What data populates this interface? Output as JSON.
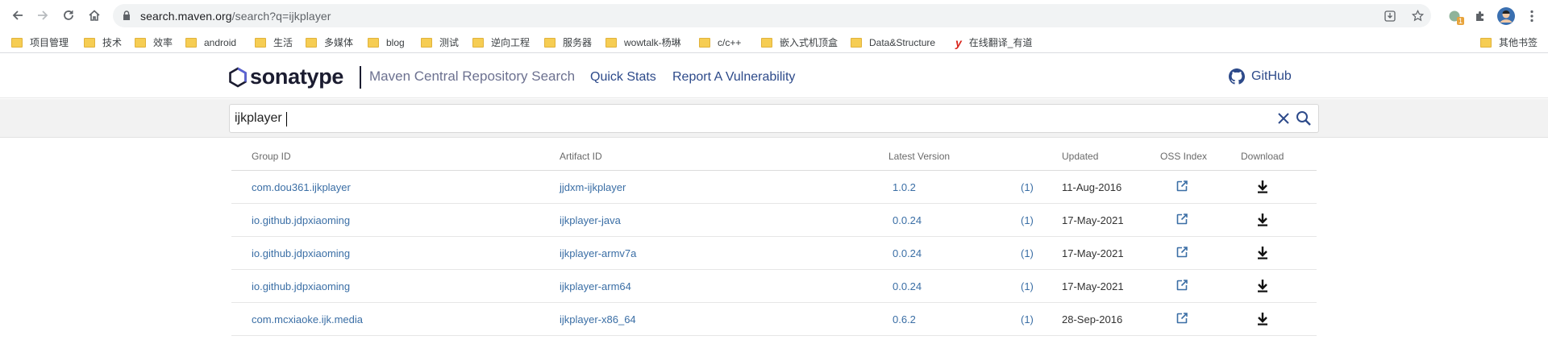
{
  "browser": {
    "url_host": "search.maven.org",
    "url_rest": "/search?q=ijkplayer",
    "extension_badge": "1"
  },
  "bookmarks": [
    {
      "label": "项目管理",
      "type": "folder"
    },
    {
      "label": "技术",
      "type": "folder"
    },
    {
      "label": "效率",
      "type": "folder"
    },
    {
      "label": "android",
      "type": "folder"
    },
    {
      "label": "生活",
      "type": "folder"
    },
    {
      "label": "多媒体",
      "type": "folder"
    },
    {
      "label": "blog",
      "type": "folder"
    },
    {
      "label": "测试",
      "type": "folder"
    },
    {
      "label": "逆向工程",
      "type": "folder"
    },
    {
      "label": "服务器",
      "type": "folder"
    },
    {
      "label": "wowtalk-杨琳",
      "type": "folder"
    },
    {
      "label": "c/c++",
      "type": "folder"
    },
    {
      "label": "嵌入式机顶盒",
      "type": "folder"
    },
    {
      "label": "Data&Structure",
      "type": "folder"
    },
    {
      "label": "在线翻译_有道",
      "type": "site"
    },
    {
      "label": "其他书签",
      "type": "folder"
    }
  ],
  "site": {
    "logo_text": "sonatype",
    "subtitle": "Maven Central Repository Search",
    "nav": [
      "Quick Stats",
      "Report A Vulnerability"
    ],
    "github_label": "GitHub",
    "brand_color": "#2d4a8a"
  },
  "search": {
    "query": "ijkplayer"
  },
  "table": {
    "headers": [
      "Group ID",
      "Artifact ID",
      "Latest Version",
      "Updated",
      "OSS Index",
      "Download"
    ],
    "rows": [
      {
        "group": "com.dou361.ijkplayer",
        "artifact": "jjdxm-ijkplayer",
        "version": "1.0.2",
        "count": "(1)",
        "updated": "11-Aug-2016"
      },
      {
        "group": "io.github.jdpxiaoming",
        "artifact": "ijkplayer-java",
        "version": "0.0.24",
        "count": "(1)",
        "updated": "17-May-2021"
      },
      {
        "group": "io.github.jdpxiaoming",
        "artifact": "ijkplayer-armv7a",
        "version": "0.0.24",
        "count": "(1)",
        "updated": "17-May-2021"
      },
      {
        "group": "io.github.jdpxiaoming",
        "artifact": "ijkplayer-arm64",
        "version": "0.0.24",
        "count": "(1)",
        "updated": "17-May-2021"
      },
      {
        "group": "com.mcxiaoke.ijk.media",
        "artifact": "ijkplayer-x86_64",
        "version": "0.6.2",
        "count": "(1)",
        "updated": "28-Sep-2016"
      }
    ]
  }
}
